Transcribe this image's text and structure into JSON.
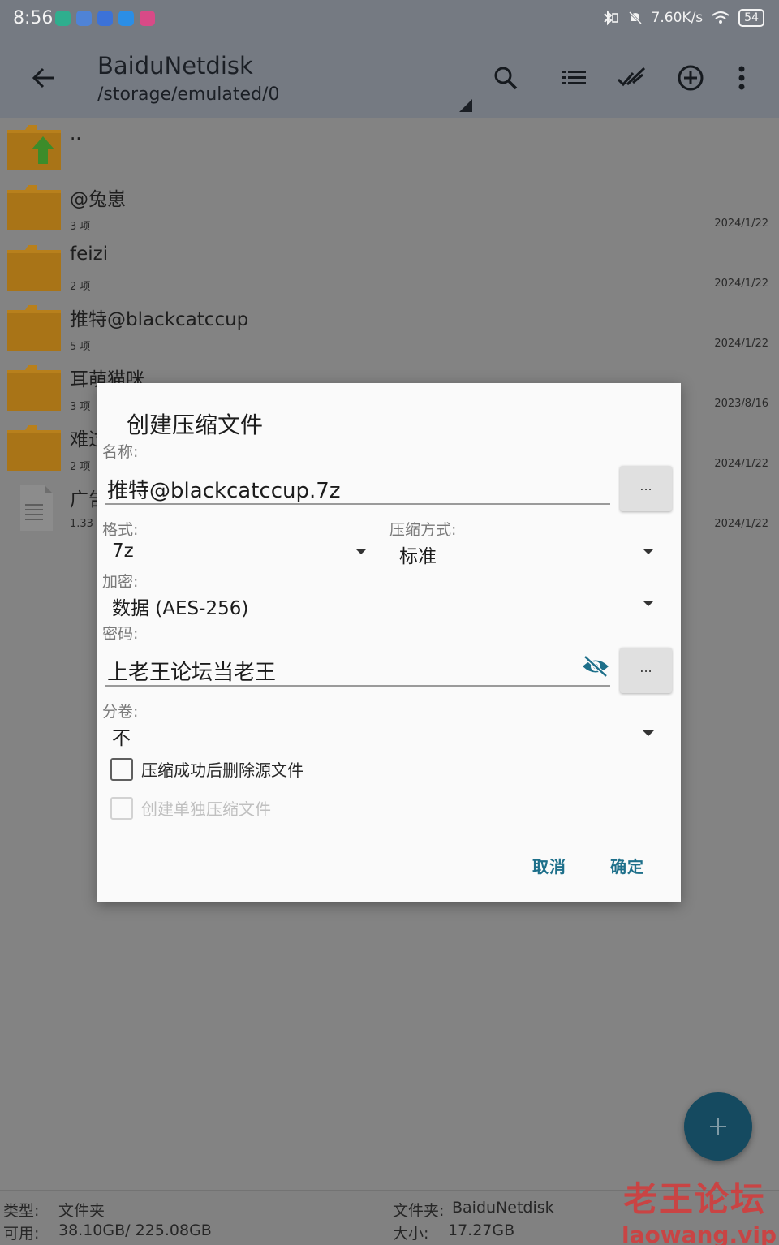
{
  "status_bar": {
    "time": "8:56",
    "speed": "7.60K/s",
    "battery": "54",
    "notification_colors": [
      "#2fae8e",
      "#4f83d6",
      "#3c72d8",
      "#2b8ee6",
      "#d84a87"
    ]
  },
  "app_bar": {
    "title": "BaiduNetdisk",
    "subtitle": "/storage/emulated/0",
    "icons": [
      "back-arrow-icon",
      "search-icon",
      "list-view-icon",
      "select-all-icon",
      "add-circle-icon",
      "more-vert-icon"
    ]
  },
  "files": [
    {
      "name": "..",
      "meta": "",
      "date": "",
      "kind": "parent"
    },
    {
      "name": "@兔崽",
      "meta": "3 项",
      "date": "2024/1/22",
      "kind": "folder"
    },
    {
      "name": "feizi",
      "meta": "2 项",
      "date": "2024/1/22",
      "kind": "folder"
    },
    {
      "name": "推特@blackcatccup",
      "meta": "5 项",
      "date": "2024/1/22",
      "kind": "folder"
    },
    {
      "name": "耳萌猫咪",
      "meta": "3 项",
      "date": "2023/8/16",
      "kind": "folder"
    },
    {
      "name": "难过",
      "meta": "2 项",
      "date": "2024/1/22",
      "kind": "folder"
    },
    {
      "name": "广告",
      "meta": "1.33",
      "date": "2024/1/22",
      "kind": "file"
    }
  ],
  "dialog": {
    "title": "创建压缩文件",
    "name_label": "名称:",
    "name_value": "推特@blackcatccup.7z",
    "dots": "...",
    "format_label": "格式:",
    "format_value": "7z",
    "method_label": "压缩方式:",
    "method_value": "标准",
    "encrypt_label": "加密:",
    "encrypt_value": "数据 (AES-256)",
    "password_label": "密码:",
    "password_value": "上老王论坛当老王",
    "volume_label": "分卷:",
    "volume_value": "不",
    "delete_source_label": "压缩成功后删除源文件",
    "separate_archive_label": "创建单独压缩文件",
    "cancel": "取消",
    "ok": "确定"
  },
  "footer": {
    "type_label": "类型:",
    "type_value": "文件夹",
    "avail_label": "可用:",
    "avail_value": "38.10GB/ 225.08GB",
    "folder_label": "文件夹:",
    "folder_value": "BaiduNetdisk",
    "size_label": "大小:",
    "size_value": "17.27GB"
  },
  "watermark": {
    "line1": "老王论坛",
    "line2": "laowang.vip"
  },
  "colors": {
    "accent": "#1d6f8a",
    "fab": "#154a60",
    "folder": "#b8801c"
  }
}
